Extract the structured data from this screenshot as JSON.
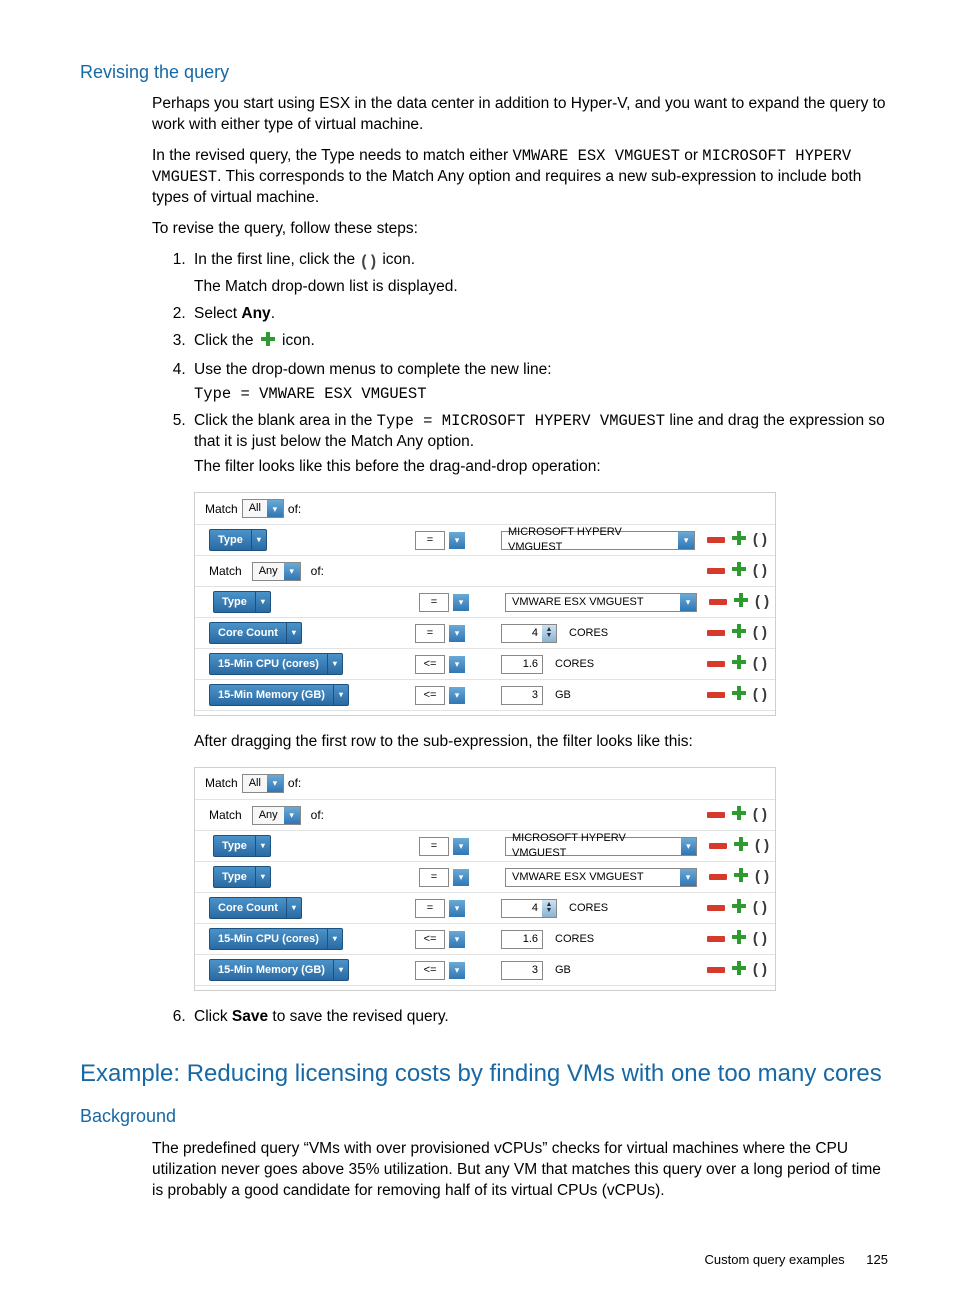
{
  "headings": {
    "revising": "Revising the query",
    "example": "Example: Reducing licensing costs by finding VMs with one too many cores",
    "background": "Background"
  },
  "intro": {
    "p1": "Perhaps you start using ESX in the data center in addition to Hyper-V, and you want to expand the query to work with either type of virtual machine.",
    "p2a": "In the revised query, the Type needs to match either ",
    "p2_code1": "VMWARE ESX VMGUEST",
    "p2b": " or ",
    "p2_code2": "MICROSOFT HYPERV VMGUEST",
    "p2c": ". This corresponds to the Match Any option and requires a new sub-expression to include both types of virtual machine.",
    "p3": "To revise the query, follow these steps:"
  },
  "steps": {
    "s1a": "In the first line, click the ",
    "s1b": " icon.",
    "s1_sub": "The Match drop-down list is displayed.",
    "s2a": "Select ",
    "s2b": "Any",
    "s2c": ".",
    "s3a": "Click the ",
    "s3b": " icon.",
    "s4": "Use the drop-down menus to complete the new line:",
    "s4_code": "Type = VMWARE ESX VMGUEST",
    "s5a": "Click the blank area in the ",
    "s5_code": "Type = MICROSOFT HYPERV VMGUEST",
    "s5b": " line and drag the expression so that it is just below the Match Any option.",
    "s5_sub": "The filter looks like this before the drag-and-drop operation:",
    "after_fig1": "After dragging the first row to the sub-expression, the filter looks like this:",
    "s6a": "Click ",
    "s6b": "Save",
    "s6c": " to save the revised query."
  },
  "bg": {
    "p1": "The predefined query “VMs with over provisioned vCPUs” checks for virtual machines where the CPU utilization never goes above 35% utilization. But any VM that matches this query over a long period of time is probably a good candidate for removing half of its virtual CPUs (vCPUs)."
  },
  "ui": {
    "match": "Match",
    "all": "All",
    "any": "Any",
    "of": "of:",
    "type": "Type",
    "corecount": "Core Count",
    "cpu": "15-Min CPU (cores)",
    "mem": "15-Min Memory (GB)",
    "eq": "=",
    "lte": "<=",
    "hyperv": "MICROSOFT HYPERV VMGUEST",
    "esx": "VMWARE ESX VMGUEST",
    "v4": "4",
    "v16": "1.6",
    "v3": "3",
    "cores": "CORES",
    "gb": "GB"
  },
  "footer": {
    "label": "Custom query examples",
    "page": "125"
  }
}
